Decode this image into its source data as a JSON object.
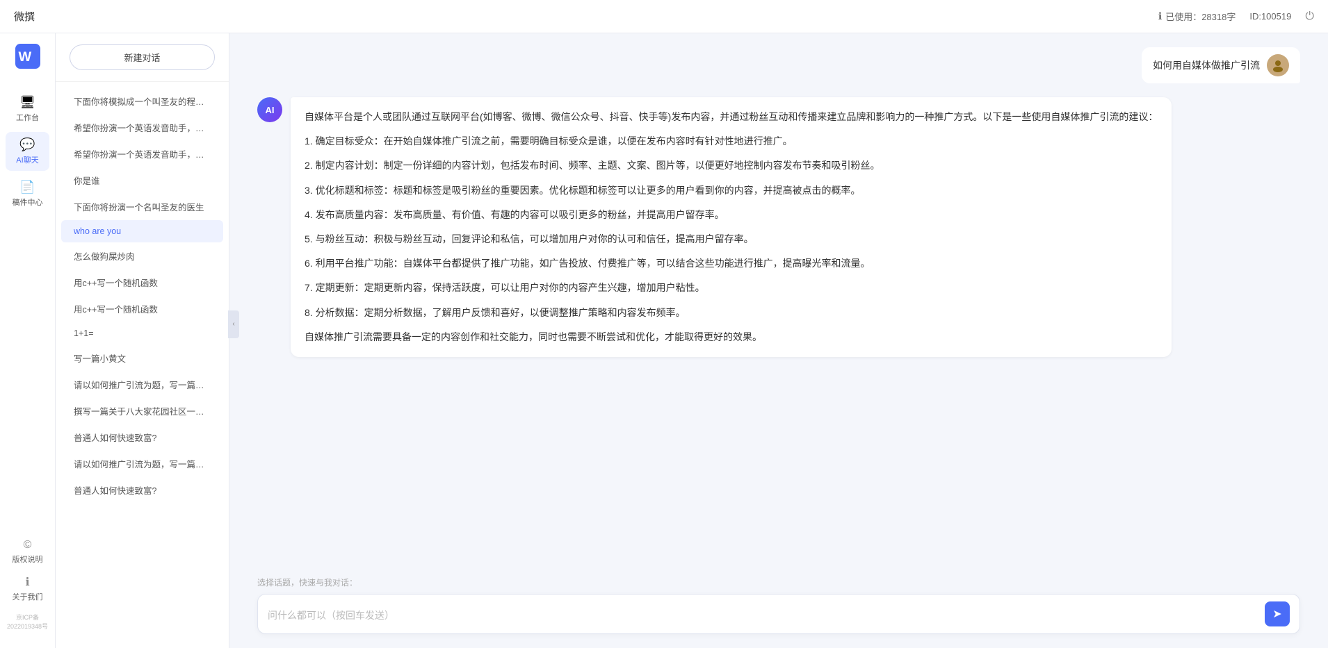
{
  "topbar": {
    "title": "微撰",
    "usage_label": "已使用：28318字",
    "id_label": "ID:100519",
    "info_icon": "ℹ",
    "power_icon": "⏻"
  },
  "left_nav": {
    "logo_text": "微撰",
    "items": [
      {
        "id": "workbench",
        "icon": "🖥",
        "label": "工作台",
        "active": false
      },
      {
        "id": "ai-chat",
        "icon": "💬",
        "label": "AI聊天",
        "active": true
      },
      {
        "id": "manuscript",
        "icon": "📄",
        "label": "稿件中心",
        "active": false
      }
    ],
    "bottom_items": [
      {
        "id": "copyright",
        "icon": "©",
        "label": "版权说明"
      },
      {
        "id": "about",
        "icon": "ℹ",
        "label": "关于我们"
      }
    ],
    "icp": "京ICP备2022019348号"
  },
  "chat_sidebar": {
    "new_chat_label": "新建对话",
    "history_items": [
      {
        "id": 1,
        "text": "下面你将模拟成一个叫圣友的程序员，我说...",
        "active": false
      },
      {
        "id": 2,
        "text": "希望你扮演一个英语发音助手，我提供给你...",
        "active": false
      },
      {
        "id": 3,
        "text": "希望你扮演一个英语发音助手，我提供给你...",
        "active": false
      },
      {
        "id": 4,
        "text": "你是谁",
        "active": false
      },
      {
        "id": 5,
        "text": "下面你将扮演一个名叫圣友的医生",
        "active": false
      },
      {
        "id": 6,
        "text": "who are you",
        "active": true
      },
      {
        "id": 7,
        "text": "怎么做狗屎炒肉",
        "active": false
      },
      {
        "id": 8,
        "text": "用c++写一个随机函数",
        "active": false
      },
      {
        "id": 9,
        "text": "用c++写一个随机函数",
        "active": false
      },
      {
        "id": 10,
        "text": "1+1=",
        "active": false
      },
      {
        "id": 11,
        "text": "写一篇小黄文",
        "active": false
      },
      {
        "id": 12,
        "text": "请以如何推广引流为题，写一篇大纲",
        "active": false
      },
      {
        "id": 13,
        "text": "撰写一篇关于八大家花园社区一刻钟便民生...",
        "active": false
      },
      {
        "id": 14,
        "text": "普通人如何快速致富?",
        "active": false
      },
      {
        "id": 15,
        "text": "请以如何推广引流为题，写一篇大纲",
        "active": false
      },
      {
        "id": 16,
        "text": "普通人如何快速致富?",
        "active": false
      }
    ]
  },
  "chat_area": {
    "user_message": "如何用自媒体做推广引流",
    "ai_response_paragraphs": [
      "自媒体平台是个人或团队通过互联网平台(如博客、微博、微信公众号、抖音、快手等)发布内容，并通过粉丝互动和传播来建立品牌和影响力的一种推广方式。以下是一些使用自媒体推广引流的建议：",
      "1. 确定目标受众：在开始自媒体推广引流之前，需要明确目标受众是谁，以便在发布内容时有针对性地进行推广。",
      "2. 制定内容计划：制定一份详细的内容计划，包括发布时间、频率、主题、文案、图片等，以便更好地控制内容发布节奏和吸引粉丝。",
      "3. 优化标题和标签：标题和标签是吸引粉丝的重要因素。优化标题和标签可以让更多的用户看到你的内容，并提高被点击的概率。",
      "4. 发布高质量内容：发布高质量、有价值、有趣的内容可以吸引更多的粉丝，并提高用户留存率。",
      "5. 与粉丝互动：积极与粉丝互动，回复评论和私信，可以增加用户对你的认可和信任，提高用户留存率。",
      "6. 利用平台推广功能：自媒体平台都提供了推广功能，如广告投放、付费推广等，可以结合这些功能进行推广，提高曝光率和流量。",
      "7. 定期更新：定期更新内容，保持活跃度，可以让用户对你的内容产生兴趣，增加用户粘性。",
      "8. 分析数据：定期分析数据，了解用户反馈和喜好，以便调整推广策略和内容发布频率。",
      "自媒体推广引流需要具备一定的内容创作和社交能力，同时也需要不断尝试和优化，才能取得更好的效果。"
    ],
    "quick_topics_label": "选择话题，快速与我对话：",
    "input_placeholder": "问什么都可以（按回车发送）"
  }
}
